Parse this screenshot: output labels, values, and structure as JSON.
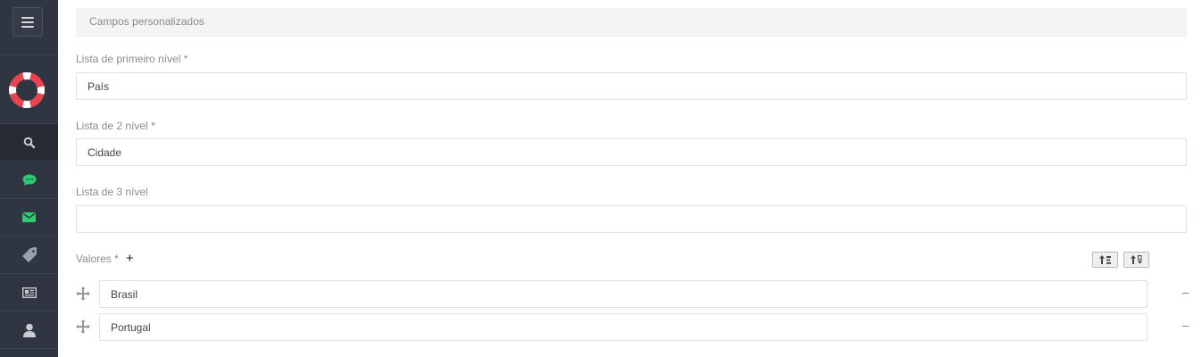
{
  "sidebar": {
    "menu_icon": "hamburger-icon",
    "logo_icon": "lifebuoy-icon",
    "items": [
      {
        "icon": "search-icon",
        "active": true
      },
      {
        "icon": "chat-icon",
        "color": "#2ecc71"
      },
      {
        "icon": "envelope-icon",
        "color": "#2ecc71"
      },
      {
        "icon": "tag-icon"
      },
      {
        "icon": "id-card-icon"
      },
      {
        "icon": "user-icon"
      }
    ]
  },
  "panel": {
    "title": "Campos personalizados"
  },
  "fields": {
    "level1": {
      "label": "Lista de primeiro nível *",
      "value": "País"
    },
    "level2": {
      "label": "Lista de 2 nível *",
      "value": "Cidade"
    },
    "level3": {
      "label": "Lista de 3 nível",
      "value": ""
    }
  },
  "values": {
    "label": "Valores *",
    "add_icon": "+",
    "remove_icon": "–",
    "items": [
      "Brasil",
      "Portugal"
    ]
  },
  "colors": {
    "sidebar_bg": "#2f3541",
    "accent_green": "#2ecc71",
    "logo_red": "#e8434f"
  }
}
